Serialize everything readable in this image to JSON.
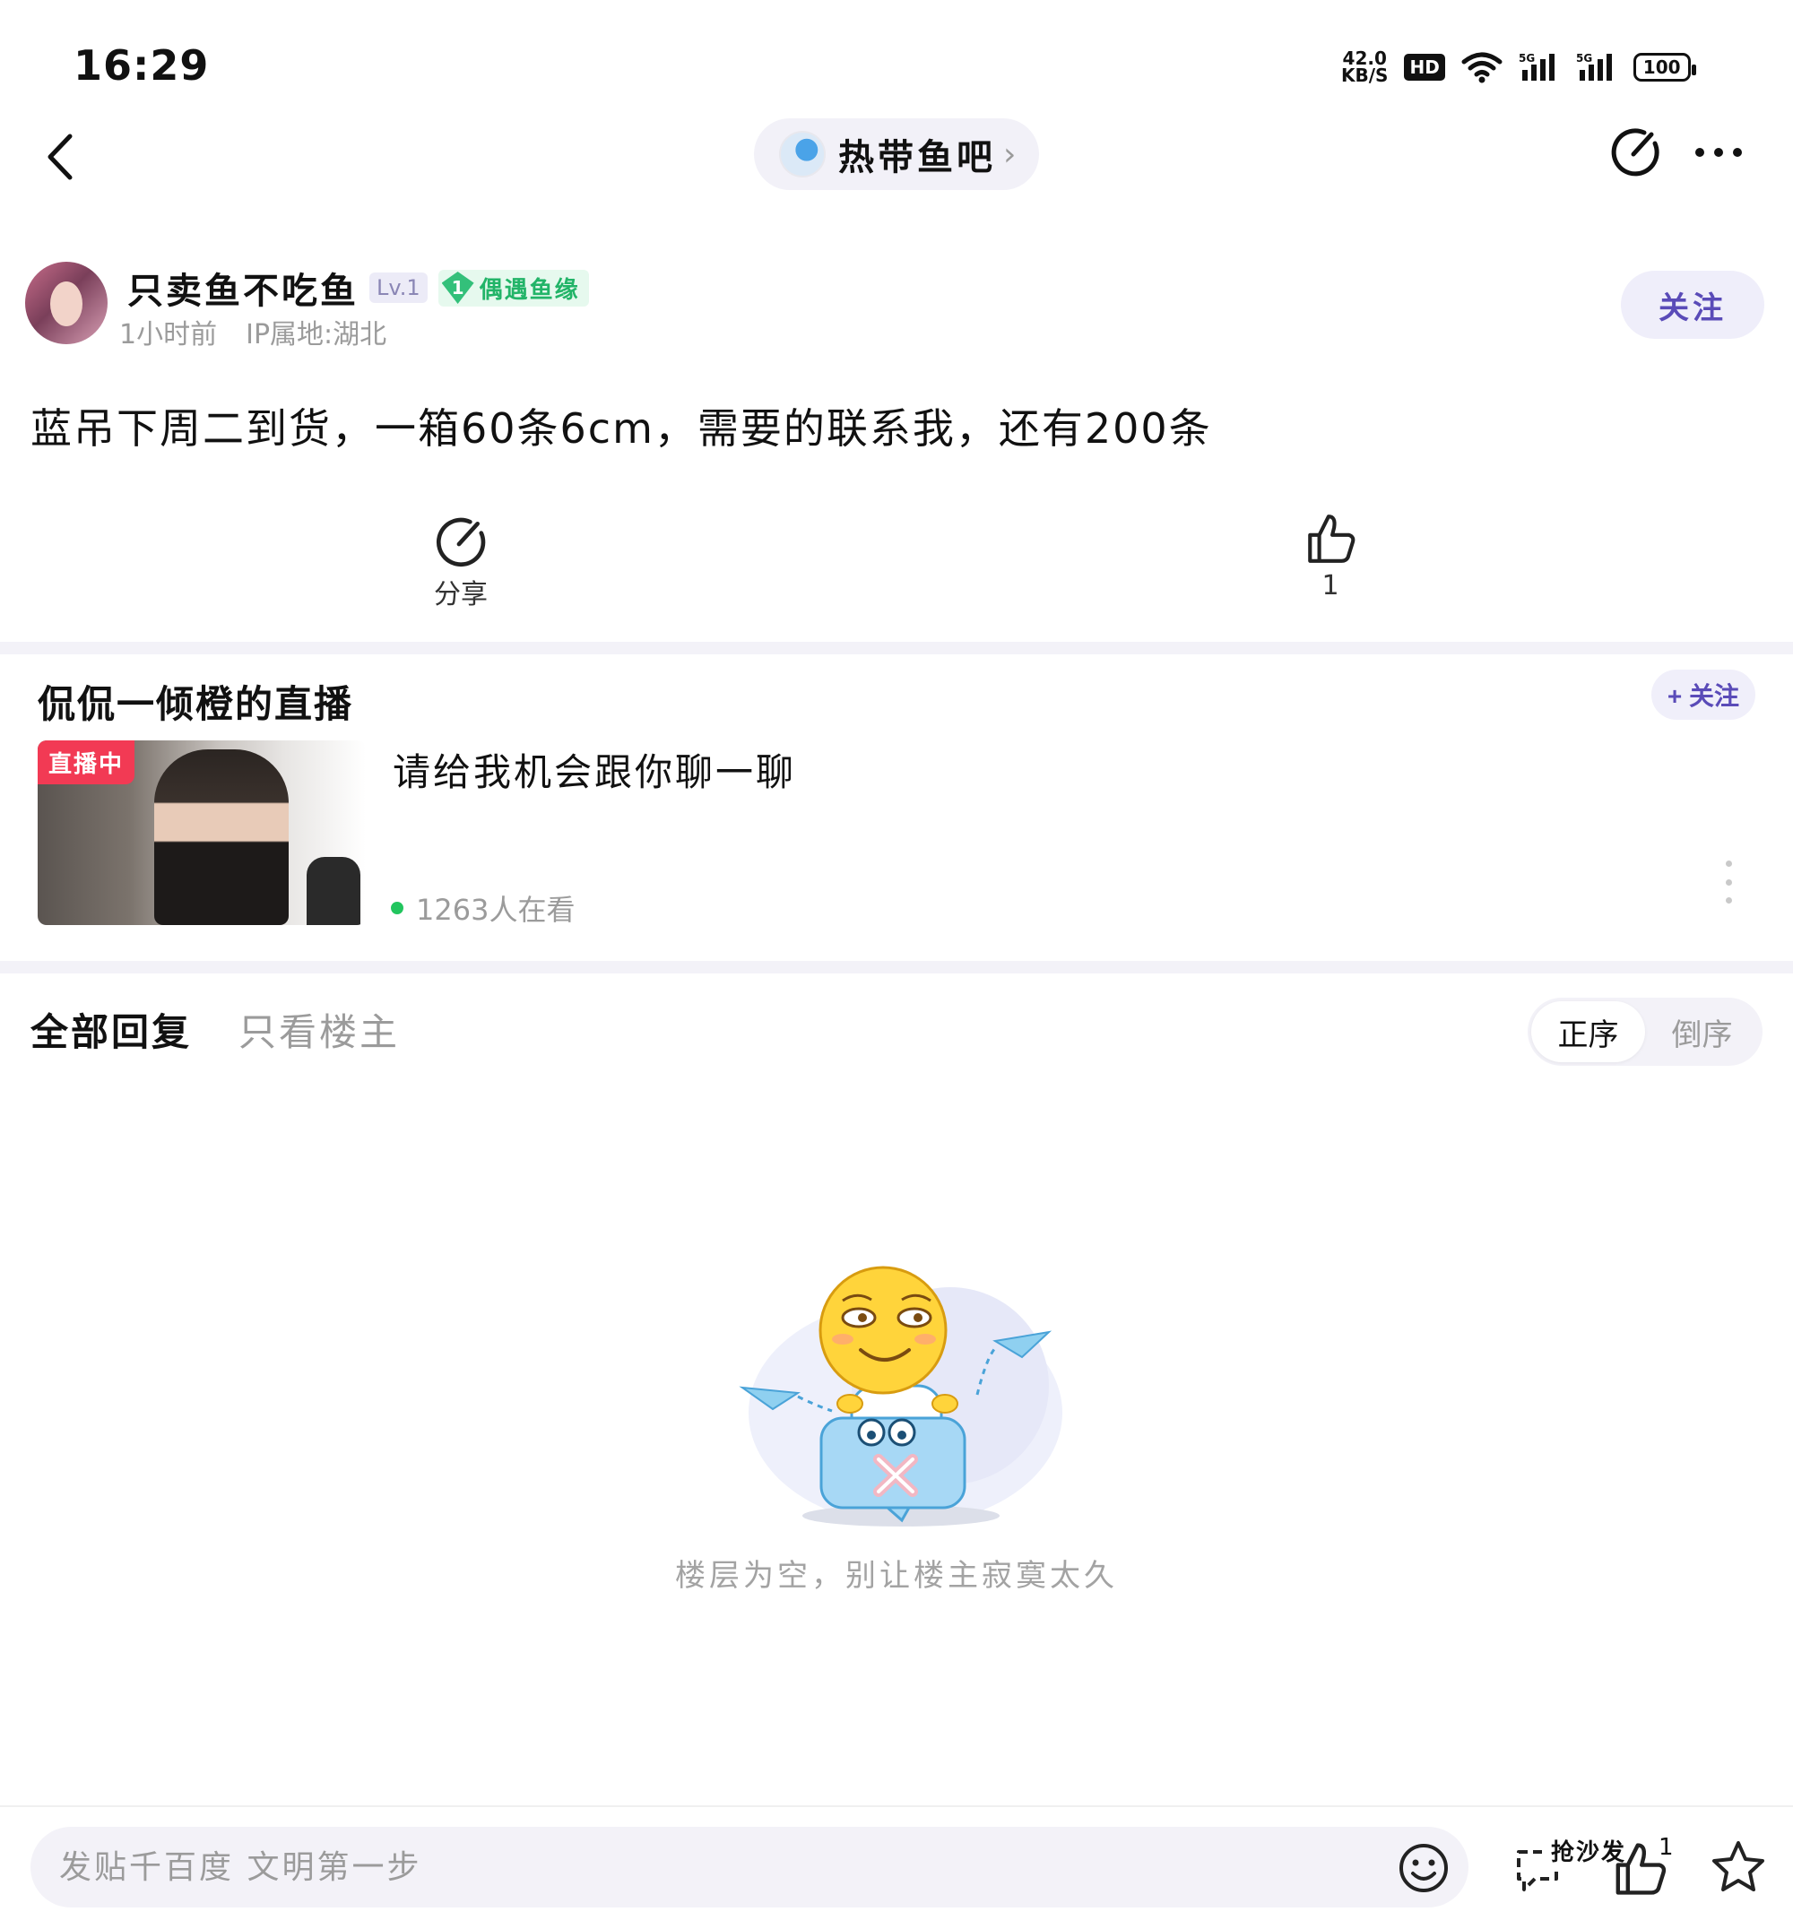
{
  "status_bar": {
    "time": "16:29",
    "net_speed_value": "42.0",
    "net_speed_unit": "KB/S",
    "hd_label": "HD",
    "battery": "100"
  },
  "nav": {
    "forum_name": "热带鱼吧",
    "forum_chevron": "›"
  },
  "author": {
    "name": "只卖鱼不吃鱼",
    "level": "Lv.1",
    "fan_level": "1",
    "fan_badge": "偶遇鱼缘",
    "time": "1小时前",
    "ip": "IP属地:湖北",
    "follow_label": "关注"
  },
  "post": {
    "content": "蓝吊下周二到货，一箱60条6cm，需要的联系我，还有200条",
    "share_label": "分享",
    "like_count": "1"
  },
  "live": {
    "title": "侃侃一倾橙的直播",
    "follow_label": "+ 关注",
    "tag": "直播中",
    "subject": "请给我机会跟你聊一聊",
    "viewers": "1263人在看"
  },
  "replies": {
    "tab_all": "全部回复",
    "tab_op": "只看楼主",
    "sort_asc": "正序",
    "sort_desc": "倒序",
    "empty_text": "楼层为空，别让楼主寂寞太久"
  },
  "bottom_bar": {
    "placeholder": "发贴千百度 文明第一步",
    "sofa_label": "抢沙发",
    "like_count": "1"
  },
  "colors": {
    "accent": "#5a4bb8",
    "live_red": "#f23a54",
    "online_green": "#22c55e",
    "fan_green": "#22b468"
  },
  "icons": [
    "back-icon",
    "share-icon",
    "more-icon",
    "like-icon",
    "emoji-icon",
    "comment-icon",
    "star-icon",
    "wifi-icon",
    "signal-icon"
  ]
}
